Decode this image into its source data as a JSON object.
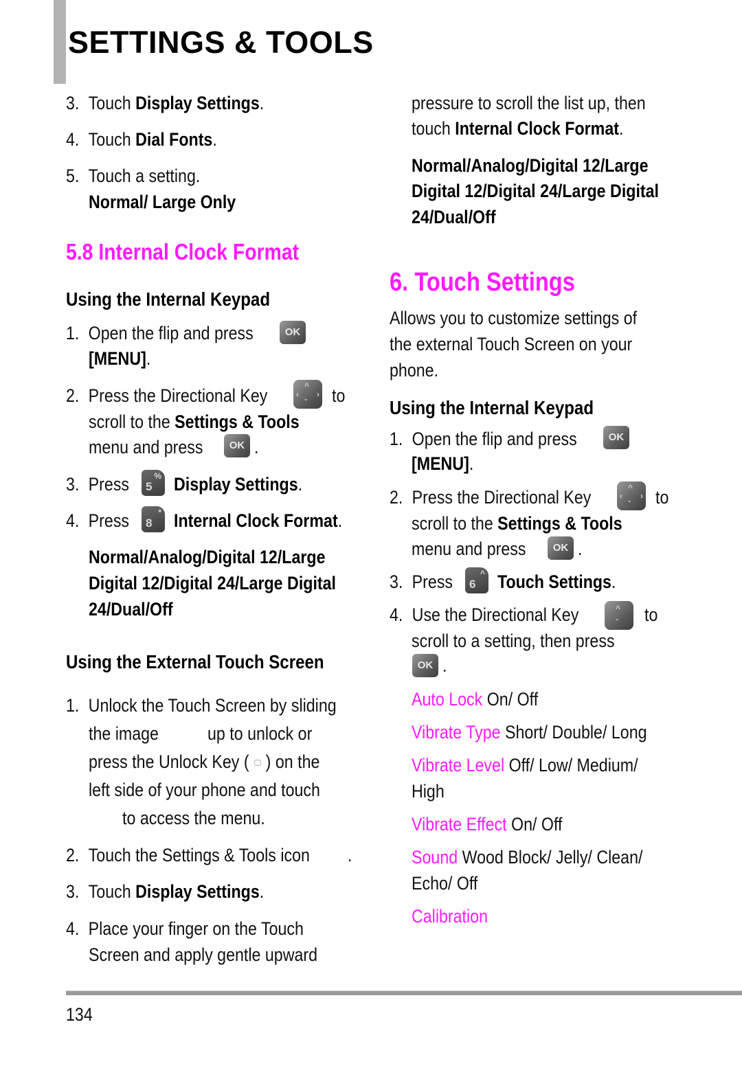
{
  "header": {
    "title": "SETTINGS & TOOLS"
  },
  "left": {
    "step3": {
      "n": "3.",
      "pre": "Touch ",
      "bold": "Display Settings",
      "post": "."
    },
    "step4": {
      "n": "4.",
      "pre": "Touch ",
      "bold": "Dial Fonts",
      "post": "."
    },
    "step5": {
      "n": "5.",
      "text": "Touch a setting.",
      "options": "Normal/ Large Only"
    },
    "section_heading": "5.8 Internal Clock Format",
    "internal_keypad": {
      "heading": "Using the Internal Keypad",
      "s1": {
        "n": "1.",
        "text": "Open the flip and press",
        "bold": "[MENU]",
        "post": "."
      },
      "s2": {
        "n": "2.",
        "text": "Press the Directional Key",
        "to": "to",
        "l2pre": "scroll to the ",
        "l2bold": "Settings & Tools",
        "l3": "menu and press",
        "l3post": "."
      },
      "s3": {
        "n": "3.",
        "text": "Press",
        "bold": "Display Settings",
        "post": ".",
        "key_digit": "5",
        "key_sym": "%"
      },
      "s4": {
        "n": "4.",
        "text": "Press",
        "bold": "Internal Clock Format",
        "post": ".",
        "key_digit": "8",
        "key_sym": "*"
      },
      "options": [
        "Normal/Analog/Digital 12/Large",
        "Digital 12/Digital 24/Large Digital",
        "24/Dual/Off"
      ]
    },
    "external_touch": {
      "heading": "Using the External Touch Screen",
      "s1": {
        "n": "1.",
        "lines": [
          "Unlock the Touch Screen by sliding",
          "the image",
          "up to unlock or",
          "press the Unlock Key (",
          ") on the",
          "left side of your phone and touch",
          "to access the menu."
        ]
      },
      "s2": {
        "n": "2.",
        "text": "Touch the Settings & Tools icon",
        "post": "."
      },
      "s3": {
        "n": "3.",
        "pre": "Touch ",
        "bold": "Display Settings",
        "post": "."
      },
      "s4": {
        "n": "4.",
        "lines": [
          "Place your finger on the Touch",
          "Screen and apply gentle upward"
        ]
      }
    },
    "ok_label": "OK"
  },
  "right": {
    "cont": {
      "l1": "pressure to scroll the list up, then",
      "l2pre": "touch ",
      "l2bold": "Internal Clock Format",
      "l2post": "."
    },
    "options": [
      "Normal/Analog/Digital 12/Large",
      "Digital 12/Digital 24/Large Digital",
      "24/Dual/Off"
    ],
    "section_heading": "6. Touch Settings",
    "description": [
      "Allows you to customize settings of",
      "the external Touch Screen on your",
      "phone."
    ],
    "internal_keypad": {
      "heading": "Using the Internal Keypad",
      "s1": {
        "n": "1.",
        "text": "Open the flip and press",
        "bold": "[MENU]",
        "post": "."
      },
      "s2": {
        "n": "2.",
        "text": "Press the Directional Key",
        "to": "to",
        "l2pre": "scroll to the ",
        "l2bold": "Settings & Tools",
        "l3": "menu and press",
        "l3post": "."
      },
      "s3": {
        "n": "3.",
        "text": "Press",
        "bold": "Touch Settings",
        "post": ".",
        "key_digit": "6",
        "key_sym": "^"
      },
      "s4": {
        "n": "4.",
        "text": "Use the Directional Key",
        "to": "to",
        "l2": "scroll to a setting, then press",
        "l3post": "."
      }
    },
    "settings": [
      {
        "name": "Auto Lock",
        "values": "On/ Off"
      },
      {
        "name": "Vibrate Type",
        "values": "Short/ Double/ Long"
      },
      {
        "name": "Vibrate Level",
        "values": " Off/ Low/ Medium/",
        "values2": "High"
      },
      {
        "name": "Vibrate Effect",
        "values": "On/ Off"
      },
      {
        "name": "Sound",
        "values": "Wood Block/ Jelly/ Clean/",
        "values2": "Echo/ Off"
      },
      {
        "name": "Calibration",
        "values": ""
      }
    ],
    "ok_label": "OK"
  },
  "footer": {
    "page_number": "134"
  },
  "colors": {
    "accent": "#ff1aff",
    "text": "#111111",
    "rule": "#9b9b9b"
  }
}
